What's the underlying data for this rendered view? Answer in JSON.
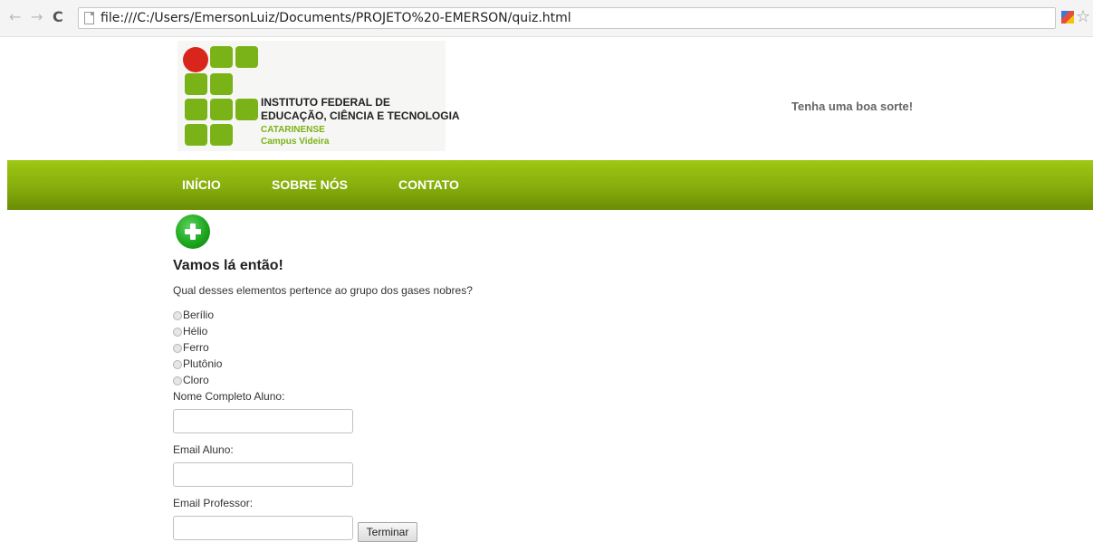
{
  "browser": {
    "back_glyph": "←",
    "forward_glyph": "→",
    "reload_glyph": "C",
    "url": "file:///C:/Users/EmersonLuiz/Documents/PROJETO%20-EMERSON/quiz.html",
    "star_glyph": "☆",
    "icons": [
      "back-arrow-icon",
      "forward-arrow-icon",
      "reload-icon",
      "page-icon",
      "extension-icon",
      "bookmark-star-icon"
    ]
  },
  "header": {
    "logo": {
      "line1": "INSTITUTO FEDERAL DE",
      "line2": "EDUCAÇÃO, CIÊNCIA E TECNOLOGIA",
      "line3": "CATARINENSE",
      "line4": "Campus Videira"
    },
    "tagline": "Tenha uma boa sorte!"
  },
  "nav": {
    "items": [
      {
        "label": "INÍCIO"
      },
      {
        "label": "SOBRE NÓS"
      },
      {
        "label": "CONTATO"
      }
    ]
  },
  "quiz": {
    "heading": "Vamos lá então!",
    "question": "Qual desses elementos pertence ao grupo dos gases nobres?",
    "options": [
      "Berílio",
      "Hélio",
      "Ferro",
      "Plutônio",
      "Cloro"
    ],
    "fields": [
      {
        "label": "Nome Completo Aluno:",
        "value": ""
      },
      {
        "label": "Email Aluno:",
        "value": ""
      },
      {
        "label": "Email Professor:",
        "value": ""
      }
    ],
    "submit_label": "Terminar"
  },
  "colors": {
    "nav_green": "#86ad0c",
    "logo_green": "#7ab317",
    "logo_red": "#d9261c",
    "plus_green": "#1ea81e"
  }
}
